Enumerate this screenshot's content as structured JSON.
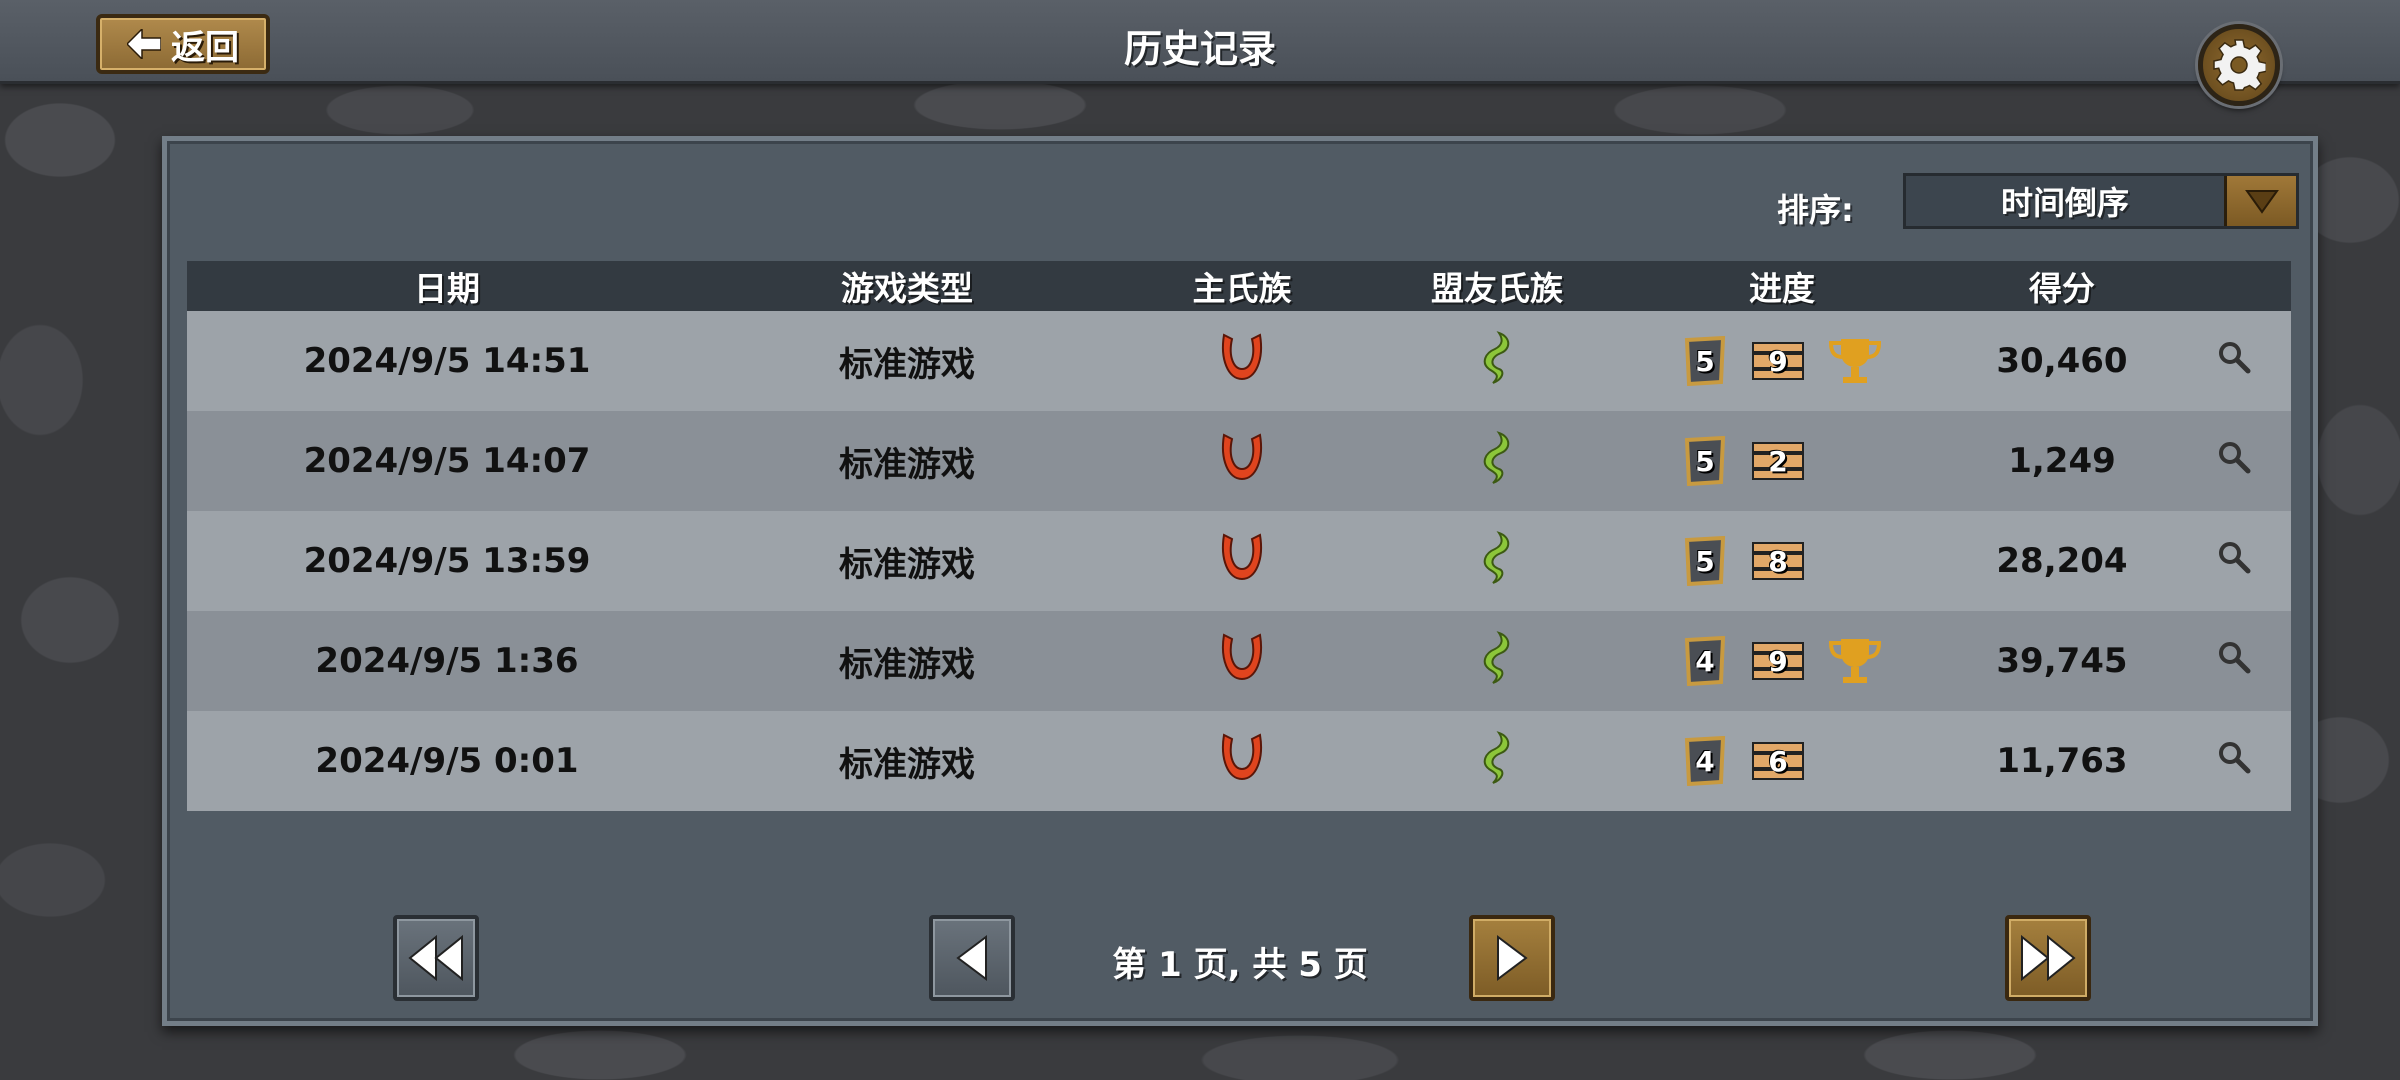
{
  "header": {
    "back_label": "返回",
    "title": "历史记录"
  },
  "sort": {
    "label": "排序:",
    "value": "时间倒序"
  },
  "table": {
    "columns": [
      "日期",
      "游戏类型",
      "主氏族",
      "盟友氏族",
      "进度",
      "得分"
    ],
    "rows": [
      {
        "date": "2024/9/5 14:51",
        "type": "标准游戏",
        "main_clan_icon": "red-horn-icon",
        "ally_clan_icon": "green-serpent-icon",
        "wave": "5",
        "level": "9",
        "trophy": true,
        "score": "30,460"
      },
      {
        "date": "2024/9/5 14:07",
        "type": "标准游戏",
        "main_clan_icon": "red-horn-icon",
        "ally_clan_icon": "green-serpent-icon",
        "wave": "5",
        "level": "2",
        "trophy": false,
        "score": "1,249"
      },
      {
        "date": "2024/9/5 13:59",
        "type": "标准游戏",
        "main_clan_icon": "red-horn-icon",
        "ally_clan_icon": "green-serpent-icon",
        "wave": "5",
        "level": "8",
        "trophy": false,
        "score": "28,204"
      },
      {
        "date": "2024/9/5 1:36",
        "type": "标准游戏",
        "main_clan_icon": "red-horn-icon",
        "ally_clan_icon": "green-serpent-icon",
        "wave": "4",
        "level": "9",
        "trophy": true,
        "score": "39,745"
      },
      {
        "date": "2024/9/5 0:01",
        "type": "标准游戏",
        "main_clan_icon": "red-horn-icon",
        "ally_clan_icon": "green-serpent-icon",
        "wave": "4",
        "level": "6",
        "trophy": false,
        "score": "11,763"
      }
    ]
  },
  "pagination": {
    "text": "第 1 页, 共 5 页"
  },
  "colors": {
    "gold_button": "#a5803e",
    "panel": "#515b64",
    "clan_main": "#e0441e",
    "clan_ally": "#8cc63a",
    "trophy": "#e0a020"
  }
}
